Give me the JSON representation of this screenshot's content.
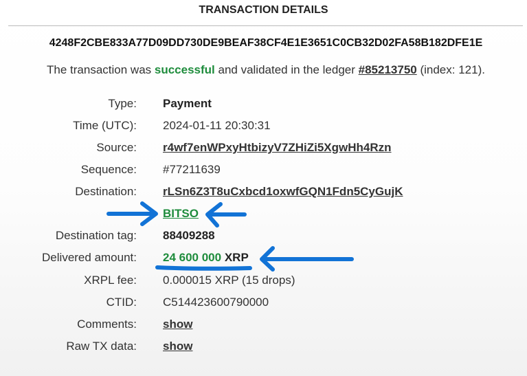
{
  "title": "TRANSACTION DETAILS",
  "hash": "4248F2CBE833A77D09DD730DE9BEAF38CF4E1E3651C0CB32D02FA58B182DFE1E",
  "status": {
    "prefix": "The transaction was ",
    "result": "successful",
    "middle": " and validated in the ledger ",
    "ledger": "#85213750",
    "suffix": " (index: 121)."
  },
  "rows": {
    "type": {
      "label": "Type:",
      "value": "Payment"
    },
    "time": {
      "label": "Time (UTC):",
      "value": "2024-01-11 20:30:31"
    },
    "source": {
      "label": "Source:",
      "value": "r4wf7enWPxyHtbizyV7ZHiZi5XgwHh4Rzn"
    },
    "sequence": {
      "label": "Sequence:",
      "value": "#77211639"
    },
    "destination": {
      "label": "Destination:",
      "value": "rLSn6Z3T8uCxbcd1oxwfGQN1Fdn5CyGujK",
      "name": "BITSO"
    },
    "dest_tag": {
      "label": "Destination tag:",
      "value": "88409288"
    },
    "delivered": {
      "label": "Delivered amount:",
      "amount": "24 600 000",
      "currency": "XRP"
    },
    "fee": {
      "label": "XRPL fee:",
      "value": "0.000015 XRP (15 drops)"
    },
    "ctid": {
      "label": "CTID:",
      "value": "C514423600790000"
    },
    "comments": {
      "label": "Comments:",
      "value": "show"
    },
    "raw": {
      "label": "Raw TX data:",
      "value": "show"
    }
  },
  "colors": {
    "success": "#1e8c3c",
    "annotation": "#1273d6"
  }
}
